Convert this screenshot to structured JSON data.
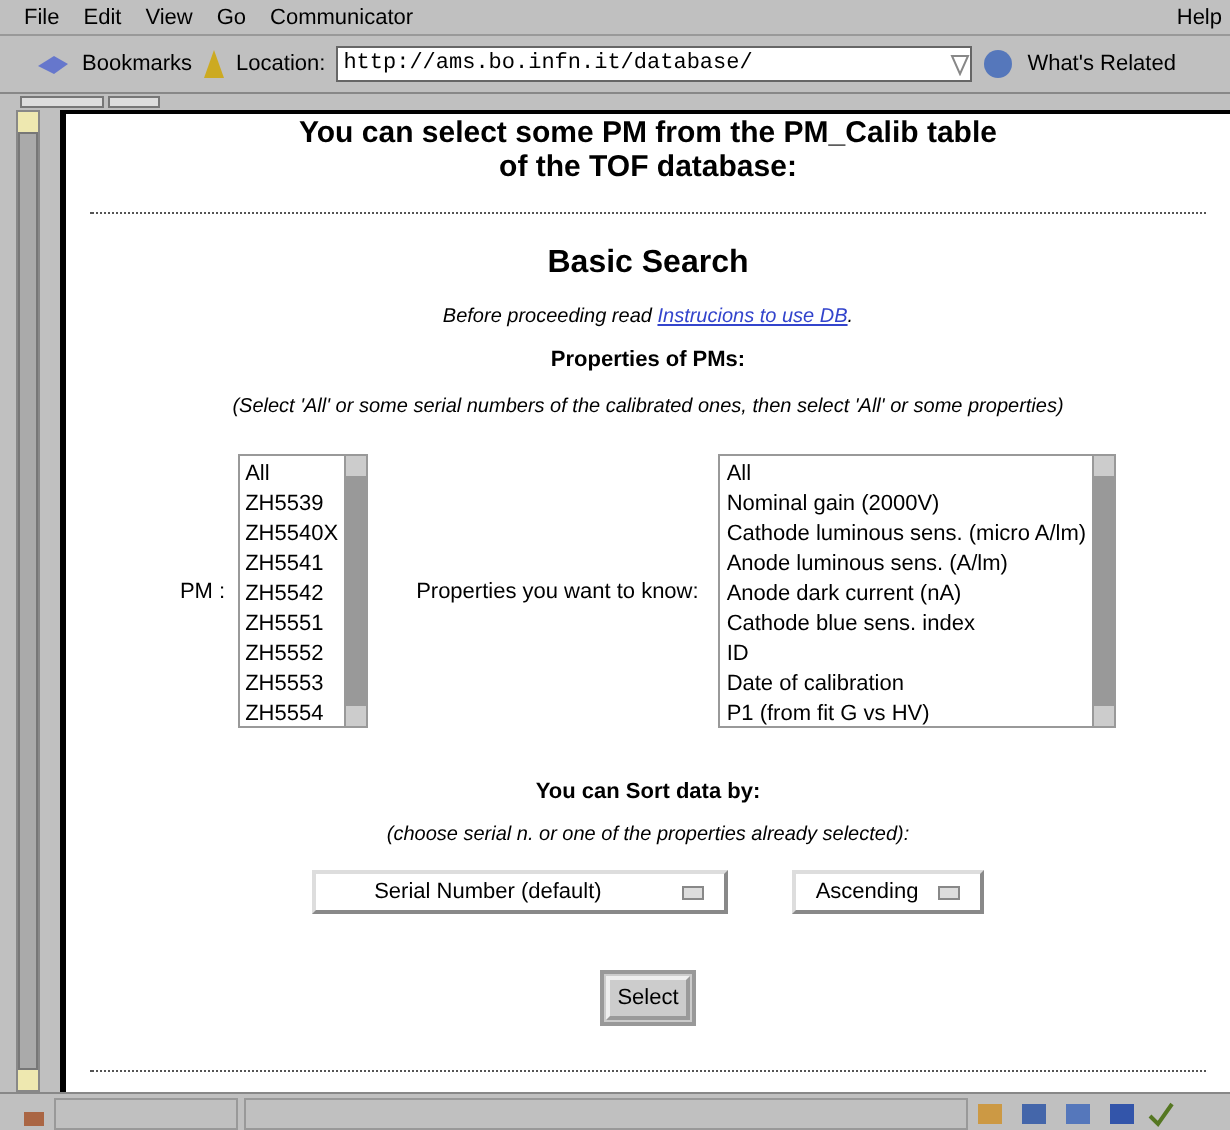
{
  "menu": [
    "File",
    "Edit",
    "View",
    "Go",
    "Communicator",
    "Help"
  ],
  "toolbar": {
    "bookmarks": "Bookmarks",
    "location_label": "Location:",
    "url": "http://ams.bo.infn.it/database/",
    "related": "What's Related"
  },
  "page": {
    "heading_lines": [
      "You can select some PM from the PM_Calib table",
      "of the TOF database:"
    ],
    "title": "Basic Search",
    "intro": "Before proceeding read",
    "intro_link": "Instrucions to use DB",
    "intro_end": ".",
    "properties_heading": "Properties of PMs:",
    "properties_note": "(Select 'All' or some serial numbers of the calibrated ones, then select 'All' or some properties)",
    "pm_label": "PM :",
    "pm_options": [
      "All",
      "ZH5539",
      "ZH5540X",
      "ZH5541",
      "ZH5542",
      "ZH5551",
      "ZH5552",
      "ZH5553",
      "ZH5554"
    ],
    "props_label": "Properties you want to know:",
    "prop_options": [
      "All",
      "Nominal gain (2000V)",
      "Cathode luminous sens. (micro A/lm)",
      "Anode luminous sens. (A/lm)",
      "Anode dark current (nA)",
      "Cathode blue sens. index",
      "ID",
      "Date of calibration",
      "P1 (from fit G vs HV)"
    ],
    "sort_heading": "You can Sort data by:",
    "sort_note": "(choose serial n. or one of the properties already selected):",
    "sort_field": "Serial Number (default)",
    "sort_order": "Ascending",
    "submit": "Select"
  }
}
